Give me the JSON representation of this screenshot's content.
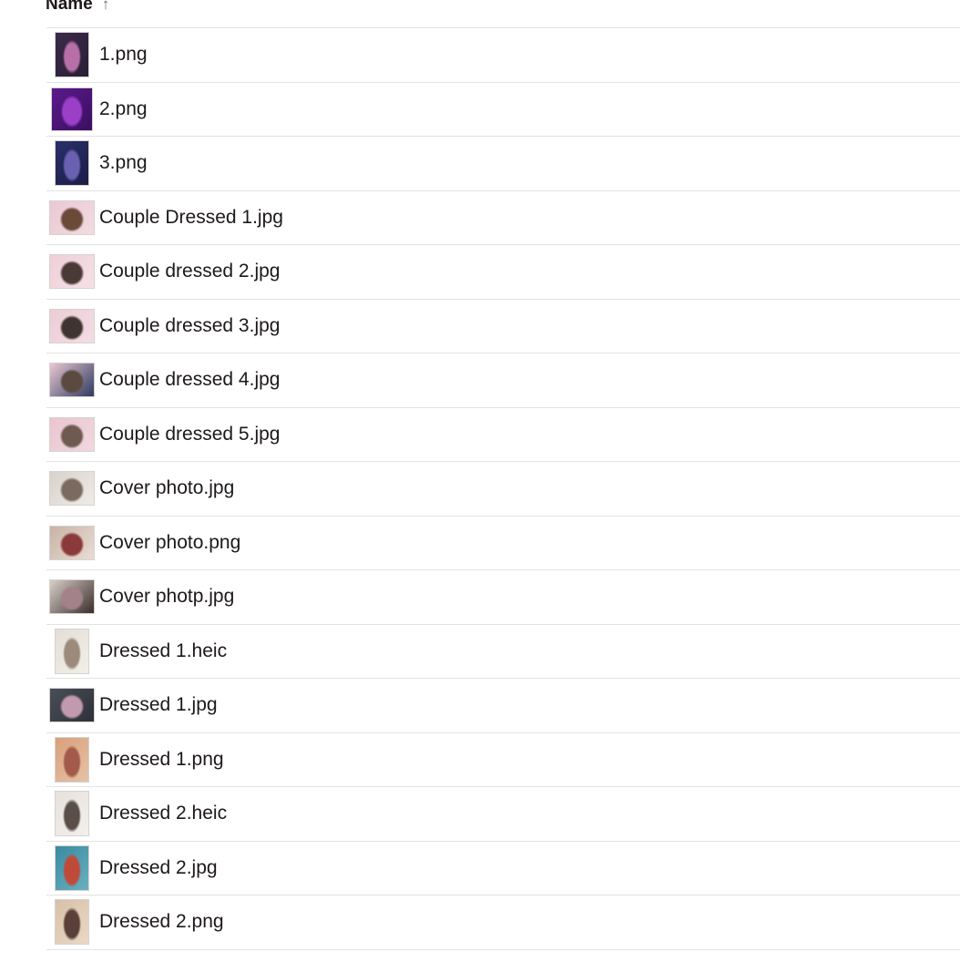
{
  "header": {
    "column_label": "Name",
    "sort_icon": "arrow-up-icon",
    "sort_glyph": "↑"
  },
  "files": [
    {
      "name": "1.png",
      "shape": "portrait",
      "colors": [
        "#3a2a4a",
        "#b86fa8",
        "#2a1f35"
      ]
    },
    {
      "name": "2.png",
      "shape": "square",
      "colors": [
        "#5b1a8c",
        "#9b3fc9",
        "#3a0f60"
      ]
    },
    {
      "name": "3.png",
      "shape": "portrait",
      "colors": [
        "#2a2f6b",
        "#6a5fb0",
        "#1b1d45"
      ]
    },
    {
      "name": "Couple Dressed 1.jpg",
      "shape": "landscape",
      "colors": [
        "#e9c9d3",
        "#6b4a3a",
        "#f2dbe2"
      ]
    },
    {
      "name": "Couple dressed 2.jpg",
      "shape": "landscape",
      "colors": [
        "#efcfd9",
        "#4a3a35",
        "#f5e0e6"
      ]
    },
    {
      "name": "Couple dressed 3.jpg",
      "shape": "landscape",
      "colors": [
        "#ecccd6",
        "#3f3430",
        "#f3dde4"
      ]
    },
    {
      "name": "Couple dressed 4.jpg",
      "shape": "landscape",
      "colors": [
        "#e8c8d2",
        "#5a4a40",
        "#2f3a60"
      ]
    },
    {
      "name": "Couple dressed 5.jpg",
      "shape": "landscape",
      "colors": [
        "#eac5cf",
        "#6e5a50",
        "#f1d8df"
      ]
    },
    {
      "name": "Cover photo.jpg",
      "shape": "landscape",
      "colors": [
        "#d8d2cc",
        "#7a6a60",
        "#efebe6"
      ]
    },
    {
      "name": "Cover photo.png",
      "shape": "landscape",
      "colors": [
        "#c9b2a6",
        "#8a3a3a",
        "#e8ddd4"
      ]
    },
    {
      "name": "Cover photp.jpg",
      "shape": "landscape",
      "colors": [
        "#d9cfc9",
        "#a3828a",
        "#3a2e2a"
      ]
    },
    {
      "name": "Dressed 1.heic",
      "shape": "portrait",
      "colors": [
        "#e3ddd6",
        "#9c8a7c",
        "#f2efe9"
      ]
    },
    {
      "name": "Dressed 1.jpg",
      "shape": "landscape",
      "colors": [
        "#4a4e58",
        "#c29ab0",
        "#2e3038"
      ]
    },
    {
      "name": "Dressed 1.png",
      "shape": "portrait",
      "colors": [
        "#d8a07a",
        "#a25a4a",
        "#e6c2a6"
      ]
    },
    {
      "name": "Dressed 2.heic",
      "shape": "portrait",
      "colors": [
        "#e6e1dc",
        "#5a4e48",
        "#f3f0ec"
      ]
    },
    {
      "name": "Dressed 2.jpg",
      "shape": "portrait",
      "colors": [
        "#3a8aa0",
        "#c04a3a",
        "#6ab0c0"
      ]
    },
    {
      "name": "Dressed 2.png",
      "shape": "portrait",
      "colors": [
        "#d8c0a8",
        "#5a4038",
        "#ead8c6"
      ]
    }
  ]
}
